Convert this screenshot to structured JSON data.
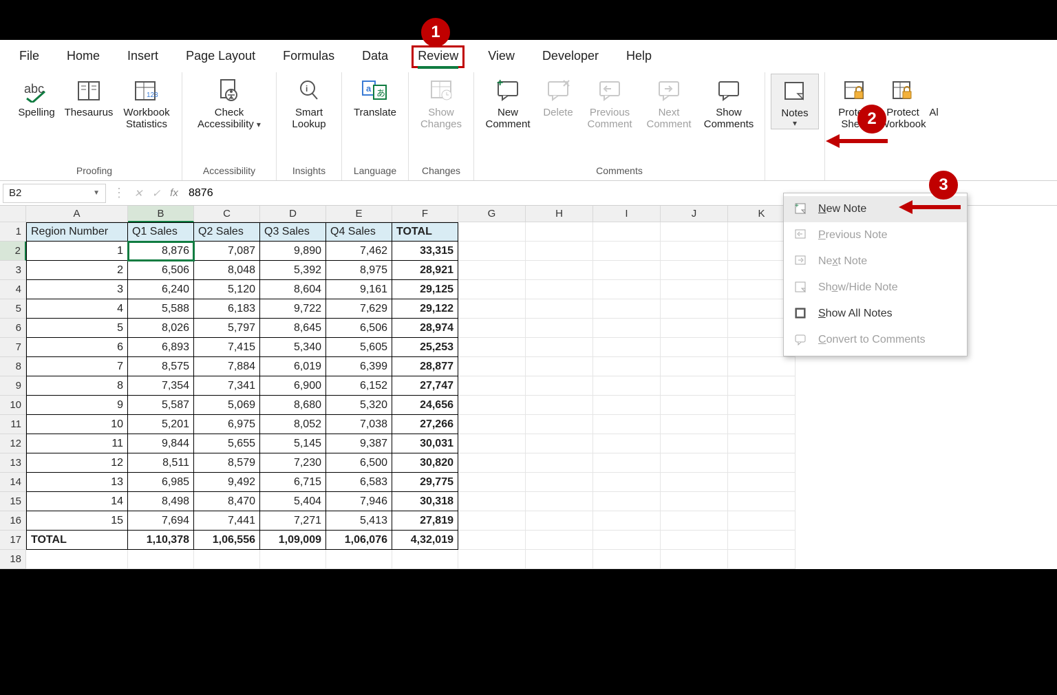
{
  "tabs": [
    "File",
    "Home",
    "Insert",
    "Page Layout",
    "Formulas",
    "Data",
    "Review",
    "View",
    "Developer",
    "Help"
  ],
  "active_tab": "Review",
  "ribbon": {
    "groups": {
      "proofing": "Proofing",
      "accessibility": "Accessibility",
      "insights": "Insights",
      "language": "Language",
      "changes": "Changes",
      "comments": "Comments"
    },
    "buttons": {
      "spelling": "Spelling",
      "thesaurus": "Thesaurus",
      "workbook_stats": "Workbook Statistics",
      "check_access": "Check Accessibility",
      "smart_lookup": "Smart Lookup",
      "translate": "Translate",
      "show_changes": "Show Changes",
      "new_comment": "New Comment",
      "delete": "Delete",
      "prev_comment": "Previous Comment",
      "next_comment": "Next Comment",
      "show_comments": "Show Comments",
      "notes": "Notes",
      "protect_sheet": "Protect Sheet",
      "protect_workbook": "Protect Workbook",
      "allow_edit": "Al"
    }
  },
  "formula_bar": {
    "cell_ref": "B2",
    "value": "8876"
  },
  "columns": [
    "A",
    "B",
    "C",
    "D",
    "E",
    "F",
    "G",
    "H",
    "I",
    "J",
    "K"
  ],
  "selected_col_index": 1,
  "selected_row_index": 1,
  "table": {
    "headers": [
      "Region Number",
      "Q1 Sales",
      "Q2 Sales",
      "Q3 Sales",
      "Q4 Sales",
      "TOTAL"
    ],
    "rows": [
      [
        "1",
        "8,876",
        "7,087",
        "9,890",
        "7,462",
        "33,315"
      ],
      [
        "2",
        "6,506",
        "8,048",
        "5,392",
        "8,975",
        "28,921"
      ],
      [
        "3",
        "6,240",
        "5,120",
        "8,604",
        "9,161",
        "29,125"
      ],
      [
        "4",
        "5,588",
        "6,183",
        "9,722",
        "7,629",
        "29,122"
      ],
      [
        "5",
        "8,026",
        "5,797",
        "8,645",
        "6,506",
        "28,974"
      ],
      [
        "6",
        "6,893",
        "7,415",
        "5,340",
        "5,605",
        "25,253"
      ],
      [
        "7",
        "8,575",
        "7,884",
        "6,019",
        "6,399",
        "28,877"
      ],
      [
        "8",
        "7,354",
        "7,341",
        "6,900",
        "6,152",
        "27,747"
      ],
      [
        "9",
        "5,587",
        "5,069",
        "8,680",
        "5,320",
        "24,656"
      ],
      [
        "10",
        "5,201",
        "6,975",
        "8,052",
        "7,038",
        "27,266"
      ],
      [
        "11",
        "9,844",
        "5,655",
        "5,145",
        "9,387",
        "30,031"
      ],
      [
        "12",
        "8,511",
        "8,579",
        "7,230",
        "6,500",
        "30,820"
      ],
      [
        "13",
        "6,985",
        "9,492",
        "6,715",
        "6,583",
        "29,775"
      ],
      [
        "14",
        "8,498",
        "8,470",
        "5,404",
        "7,946",
        "30,318"
      ],
      [
        "15",
        "7,694",
        "7,441",
        "7,271",
        "5,413",
        "27,819"
      ]
    ],
    "footer": [
      "TOTAL",
      "1,10,378",
      "1,06,556",
      "1,09,009",
      "1,06,076",
      "4,32,019"
    ],
    "empty_rows_after": 1
  },
  "notes_menu": [
    {
      "label": "New Note",
      "enabled": true,
      "highlight": true,
      "ul": "N"
    },
    {
      "label": "Previous Note",
      "enabled": false,
      "ul": "P"
    },
    {
      "label": "Next Note",
      "enabled": false,
      "ul": "x"
    },
    {
      "label": "Show/Hide Note",
      "enabled": false,
      "ul": "o"
    },
    {
      "label": "Show All Notes",
      "enabled": true,
      "ul": "S"
    },
    {
      "label": "Convert to Comments",
      "enabled": false,
      "ul": "C"
    }
  ],
  "callouts": {
    "1": "1",
    "2": "2",
    "3": "3"
  }
}
